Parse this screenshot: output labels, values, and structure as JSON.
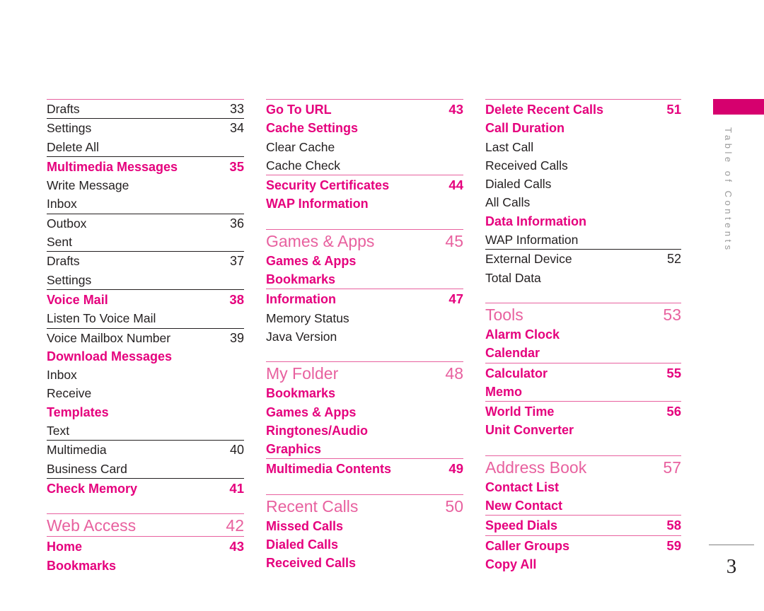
{
  "document": {
    "page_number": "3",
    "side_tab_label": "Table of Contents",
    "accent_magenta": "#e5007d",
    "accent_pink": "#e8619f",
    "accent_bar": "#d6006e",
    "text_color": "#231f20"
  },
  "columns": [
    {
      "rows": [
        {
          "label": "Drafts",
          "page": "33",
          "style": "item",
          "rule": "pink",
          "gap": false
        },
        {
          "label": "Settings",
          "page": "34",
          "style": "item",
          "rule": "dark",
          "gap": false
        },
        {
          "label": "Delete All",
          "page": "",
          "style": "item",
          "rule": "none",
          "gap": false
        },
        {
          "label": "Multimedia Messages",
          "page": "35",
          "style": "sub",
          "rule": "dark",
          "gap": false
        },
        {
          "label": "Write Message",
          "page": "",
          "style": "item",
          "rule": "none",
          "gap": false
        },
        {
          "label": "Inbox",
          "page": "",
          "style": "item",
          "rule": "none",
          "gap": false
        },
        {
          "label": "Outbox",
          "page": "36",
          "style": "item",
          "rule": "dark",
          "gap": false
        },
        {
          "label": "Sent",
          "page": "",
          "style": "item",
          "rule": "none",
          "gap": false
        },
        {
          "label": "Drafts",
          "page": "37",
          "style": "item",
          "rule": "dark",
          "gap": false
        },
        {
          "label": "Settings",
          "page": "",
          "style": "item",
          "rule": "none",
          "gap": false
        },
        {
          "label": "Voice Mail",
          "page": "38",
          "style": "sub",
          "rule": "dark",
          "gap": false
        },
        {
          "label": "Listen To Voice Mail",
          "page": "",
          "style": "item",
          "rule": "none",
          "gap": false
        },
        {
          "label": "Voice Mailbox Number",
          "page": "39",
          "style": "item",
          "rule": "dark",
          "gap": false
        },
        {
          "label": "Download Messages",
          "page": "",
          "style": "sub",
          "rule": "none",
          "gap": false
        },
        {
          "label": "Inbox",
          "page": "",
          "style": "item",
          "rule": "none",
          "gap": false
        },
        {
          "label": "Receive",
          "page": "",
          "style": "item",
          "rule": "none",
          "gap": false
        },
        {
          "label": "Templates",
          "page": "",
          "style": "sub",
          "rule": "none",
          "gap": false
        },
        {
          "label": "Text",
          "page": "",
          "style": "item",
          "rule": "none",
          "gap": false
        },
        {
          "label": "Multimedia",
          "page": "40",
          "style": "item",
          "rule": "dark",
          "gap": false
        },
        {
          "label": "Business Card",
          "page": "",
          "style": "item",
          "rule": "none",
          "gap": false
        },
        {
          "label": "Check Memory",
          "page": "41",
          "style": "sub",
          "rule": "dark",
          "gap": false
        },
        {
          "label": "Web Access",
          "page": "42",
          "style": "section",
          "rule": "pink",
          "gap": true
        },
        {
          "label": "Home",
          "page": "43",
          "style": "sub",
          "rule": "pink",
          "gap": false
        },
        {
          "label": "Bookmarks",
          "page": "",
          "style": "sub",
          "rule": "none",
          "gap": false
        }
      ]
    },
    {
      "rows": [
        {
          "label": "Go To URL",
          "page": "43",
          "style": "sub",
          "rule": "pink",
          "gap": false
        },
        {
          "label": "Cache Settings",
          "page": "",
          "style": "sub",
          "rule": "none",
          "gap": false
        },
        {
          "label": "Clear Cache",
          "page": "",
          "style": "item",
          "rule": "none",
          "gap": false
        },
        {
          "label": "Cache Check",
          "page": "",
          "style": "item",
          "rule": "none",
          "gap": false
        },
        {
          "label": "Security Certificates",
          "page": "44",
          "style": "sub",
          "rule": "pink",
          "gap": false
        },
        {
          "label": "WAP Information",
          "page": "",
          "style": "sub",
          "rule": "none",
          "gap": false
        },
        {
          "label": "Games & Apps",
          "page": "45",
          "style": "section",
          "rule": "pink",
          "gap": true
        },
        {
          "label": "Games & Apps",
          "page": "",
          "style": "sub",
          "rule": "none",
          "gap": false
        },
        {
          "label": "Bookmarks",
          "page": "",
          "style": "sub",
          "rule": "none",
          "gap": false
        },
        {
          "label": "Information",
          "page": "47",
          "style": "sub",
          "rule": "pink",
          "gap": false
        },
        {
          "label": "Memory Status",
          "page": "",
          "style": "item",
          "rule": "none",
          "gap": false
        },
        {
          "label": "Java Version",
          "page": "",
          "style": "item",
          "rule": "none",
          "gap": false
        },
        {
          "label": "My Folder",
          "page": "48",
          "style": "section",
          "rule": "pink",
          "gap": true
        },
        {
          "label": "Bookmarks",
          "page": "",
          "style": "sub",
          "rule": "none",
          "gap": false
        },
        {
          "label": "Games & Apps",
          "page": "",
          "style": "sub",
          "rule": "none",
          "gap": false
        },
        {
          "label": "Ringtones/Audio",
          "page": "",
          "style": "sub",
          "rule": "none",
          "gap": false
        },
        {
          "label": "Graphics",
          "page": "",
          "style": "sub",
          "rule": "none",
          "gap": false
        },
        {
          "label": "Multimedia Contents",
          "page": "49",
          "style": "sub",
          "rule": "pink",
          "gap": false
        },
        {
          "label": "Recent Calls",
          "page": "50",
          "style": "section",
          "rule": "pink",
          "gap": true
        },
        {
          "label": "Missed Calls",
          "page": "",
          "style": "sub",
          "rule": "none",
          "gap": false
        },
        {
          "label": "Dialed Calls",
          "page": "",
          "style": "sub",
          "rule": "none",
          "gap": false
        },
        {
          "label": "Received Calls",
          "page": "",
          "style": "sub",
          "rule": "none",
          "gap": false
        }
      ]
    },
    {
      "rows": [
        {
          "label": "Delete Recent Calls",
          "page": "51",
          "style": "sub",
          "rule": "pink",
          "gap": false
        },
        {
          "label": "Call Duration",
          "page": "",
          "style": "sub",
          "rule": "none",
          "gap": false
        },
        {
          "label": "Last Call",
          "page": "",
          "style": "item",
          "rule": "none",
          "gap": false
        },
        {
          "label": "Received Calls",
          "page": "",
          "style": "item",
          "rule": "none",
          "gap": false
        },
        {
          "label": "Dialed Calls",
          "page": "",
          "style": "item",
          "rule": "none",
          "gap": false
        },
        {
          "label": "All Calls",
          "page": "",
          "style": "item",
          "rule": "none",
          "gap": false
        },
        {
          "label": "Data Information",
          "page": "",
          "style": "sub",
          "rule": "none",
          "gap": false
        },
        {
          "label": "WAP Information",
          "page": "",
          "style": "item",
          "rule": "none",
          "gap": false
        },
        {
          "label": "External Device",
          "page": "52",
          "style": "item",
          "rule": "dark",
          "gap": false
        },
        {
          "label": "Total Data",
          "page": "",
          "style": "item",
          "rule": "none",
          "gap": false
        },
        {
          "label": "Tools",
          "page": "53",
          "style": "section",
          "rule": "pink",
          "gap": true
        },
        {
          "label": "Alarm Clock",
          "page": "",
          "style": "sub",
          "rule": "none",
          "gap": false
        },
        {
          "label": "Calendar",
          "page": "",
          "style": "sub",
          "rule": "none",
          "gap": false
        },
        {
          "label": "Calculator",
          "page": "55",
          "style": "sub",
          "rule": "pink",
          "gap": false
        },
        {
          "label": "Memo",
          "page": "",
          "style": "sub",
          "rule": "none",
          "gap": false
        },
        {
          "label": "World Time",
          "page": "56",
          "style": "sub",
          "rule": "pink",
          "gap": false
        },
        {
          "label": "Unit Converter",
          "page": "",
          "style": "sub",
          "rule": "none",
          "gap": false
        },
        {
          "label": "Address Book",
          "page": "57",
          "style": "section",
          "rule": "pink",
          "gap": true
        },
        {
          "label": "Contact List",
          "page": "",
          "style": "sub",
          "rule": "none",
          "gap": false
        },
        {
          "label": "New Contact",
          "page": "",
          "style": "sub",
          "rule": "none",
          "gap": false
        },
        {
          "label": "Speed Dials",
          "page": "58",
          "style": "sub",
          "rule": "pink",
          "gap": false
        },
        {
          "label": "Caller Groups",
          "page": "59",
          "style": "sub",
          "rule": "pink",
          "gap": false
        },
        {
          "label": "Copy All",
          "page": "",
          "style": "sub",
          "rule": "none",
          "gap": false
        }
      ]
    }
  ]
}
